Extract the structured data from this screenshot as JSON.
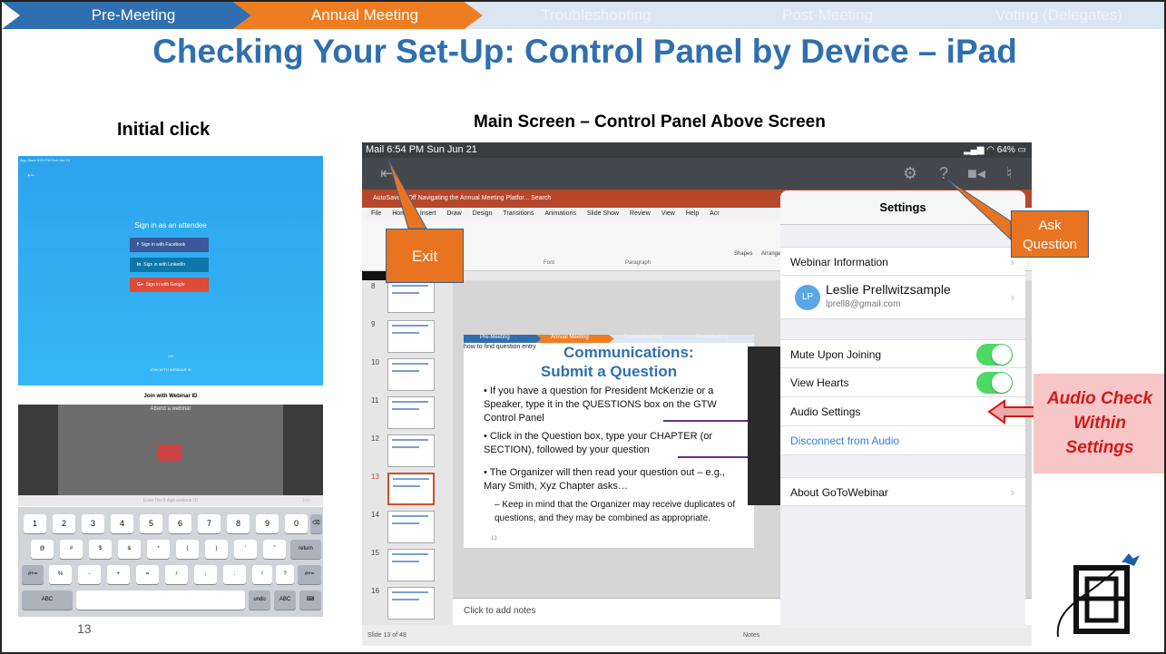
{
  "nav": {
    "steps": [
      "Pre-Meeting",
      "Annual Meeting",
      "Troubleshooting",
      "Post-Meeting",
      "Voting (Delegates)"
    ],
    "colors": [
      "#2f6fb0",
      "#ee7d22",
      "#dbe6f2",
      "#dbe6f2",
      "#dbe6f2"
    ]
  },
  "title": "Checking Your Set-Up: Control Panel by Device – iPad",
  "left_heading": "Initial click",
  "main_heading": "Main Screen – Control Panel Above Screen",
  "page_number": "13",
  "shot1": {
    "status": "App Store  6:53 PM  Sun Jun 21",
    "back_icon": "arrow-left-icon",
    "heading": "Sign in as an attendee",
    "buttons": [
      {
        "label": "Sign in with Facebook",
        "color": "#3b5998",
        "glyph": "f"
      },
      {
        "label": "Sign in with LinkedIn",
        "color": "#0e76a8",
        "glyph": "in"
      },
      {
        "label": "Sign in with Google",
        "color": "#dd4b39",
        "glyph": "G+"
      }
    ],
    "or": "OR",
    "join_link": "JOIN WITH WEBINAR ID"
  },
  "shot2": {
    "header": "Join with Webinar ID",
    "attend": "Attend a webinar",
    "input_placeholder": "Enter the 9 digit webinar ID",
    "join_label": "Join",
    "row1": [
      "1",
      "2",
      "3",
      "4",
      "5",
      "6",
      "7",
      "8",
      "9",
      "0"
    ],
    "row2": [
      "@",
      "#",
      "$",
      "&",
      "*",
      "(",
      ")",
      "’",
      "”",
      "return"
    ],
    "row3": [
      "#+=",
      "%",
      "-",
      "+",
      "=",
      "/",
      ";",
      ":",
      "!",
      "?",
      "#+="
    ],
    "row4": [
      "ABC",
      "undo",
      "ABC"
    ]
  },
  "ipad": {
    "status_left": "Mail  6:54 PM  Sun Jun 21",
    "status_right": "64%",
    "ppt_title": "AutoSave ● Off   Navigating the Annual Meeting Platfor...        Search",
    "menu": [
      "File",
      "Home",
      "Insert",
      "Draw",
      "Design",
      "Transitions",
      "Animations",
      "Slide Show",
      "Review",
      "View",
      "Help",
      "Acr"
    ],
    "ribbon_labels": [
      "Font",
      "Paragraph",
      "Shapes",
      "Arrange"
    ],
    "thumb_numbers": [
      "8",
      "9",
      "10",
      "11",
      "12",
      "13",
      "14",
      "15",
      "16"
    ],
    "notes": "Click to add notes",
    "statusbar": "Slide 13 of 48",
    "statusbar_right": "Notes",
    "embedded": {
      "nav": [
        "Pre-Meeting",
        "Annual Meeting",
        "Troubleshooting",
        "Post-Meeting"
      ],
      "small_text": "how to find question entry",
      "title_line1": "Communications:",
      "title_line2": "Submit a Question",
      "bullets": [
        "• If you have a question for President McKenzie or a Speaker, type it in the QUESTIONS box on the GTW Control Panel",
        "• Click in the Question box, type your CHAPTER (or SECTION), followed by your question",
        "• The Organizer will then read your question out – e.g., Mary Smith, Xyz Chapter asks…",
        "– Keep in mind that the Organizer may receive duplicates of questions, and they may be combined as appropriate."
      ],
      "footer_num": "13"
    }
  },
  "settings": {
    "header": "Settings",
    "webinar_info": "Webinar Information",
    "user_initials": "LP",
    "user_name": "Leslie Prellwitzsample",
    "user_email": "lprell8@gmail.com",
    "mute": "Mute Upon Joining",
    "hearts": "View Hearts",
    "audio": "Audio Settings",
    "disconnect": "Disconnect from Audio",
    "about": "About GoToWebinar"
  },
  "callouts": {
    "exit": "Exit",
    "ask_line1": "Ask",
    "ask_line2": "Question",
    "audio_line1": "Audio Check",
    "audio_line2": "Within",
    "audio_line3": "Settings"
  },
  "icons": [
    "exit-icon",
    "gear-icon",
    "question-icon",
    "camera-icon",
    "microphone-icon",
    "signal-icon",
    "wifi-icon",
    "battery-icon",
    "airplane-logo-icon"
  ]
}
